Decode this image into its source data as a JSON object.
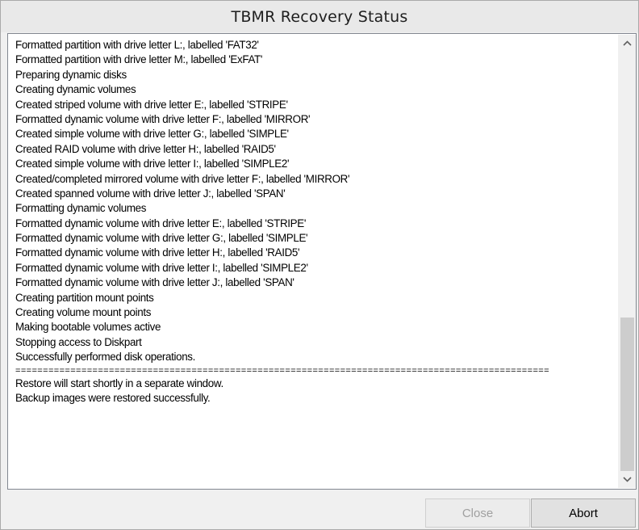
{
  "window": {
    "title": "TBMR Recovery Status"
  },
  "log": {
    "lines": [
      "Formatted partition with drive letter L:, labelled 'FAT32'",
      "Formatted partition with drive letter M:, labelled 'ExFAT'",
      "Preparing dynamic disks",
      "Creating dynamic volumes",
      "Created striped volume with drive letter E:, labelled 'STRIPE'",
      "Formatted dynamic volume with drive letter F:, labelled 'MIRROR'",
      "Created simple volume with drive letter G:, labelled 'SIMPLE'",
      "Created RAID volume with drive letter H:, labelled 'RAID5'",
      "Created simple volume with drive letter I:, labelled 'SIMPLE2'",
      "Created/completed mirrored volume with drive letter F:, labelled 'MIRROR'",
      "Created spanned volume with drive letter J:, labelled 'SPAN'",
      "Formatting dynamic volumes",
      "Formatted dynamic volume with drive letter E:, labelled 'STRIPE'",
      "Formatted dynamic volume with drive letter G:, labelled 'SIMPLE'",
      "Formatted dynamic volume with drive letter H:, labelled 'RAID5'",
      "Formatted dynamic volume with drive letter I:, labelled 'SIMPLE2'",
      "Formatted dynamic volume with drive letter J:, labelled 'SPAN'",
      "Creating partition mount points",
      "Creating volume mount points",
      "Making bootable volumes active",
      "Stopping access to Diskpart",
      "Successfully performed disk operations."
    ],
    "separator": "=================================================================================================",
    "after_lines": [
      "Restore will start shortly in a separate window.",
      "Backup images were restored successfully."
    ]
  },
  "buttons": {
    "close_label": "Close",
    "abort_label": "Abort"
  },
  "scrollbar": {
    "position_fraction": 0.9
  },
  "colors": {
    "title_bg": "#e9e9e9",
    "dialog_bg": "#f0f0f0",
    "log_bg": "#ffffff",
    "disabled_text": "#a0a0a0"
  }
}
